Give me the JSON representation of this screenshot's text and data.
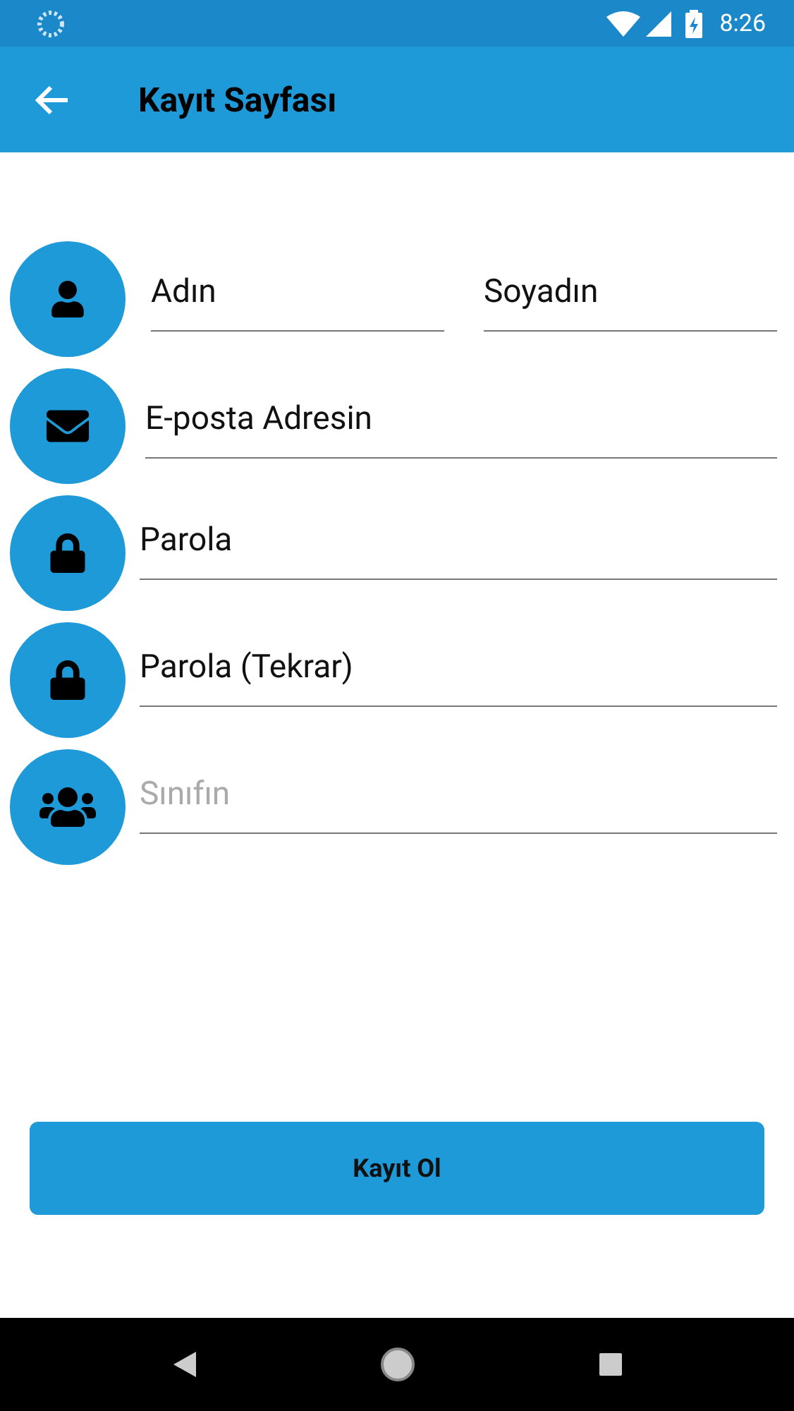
{
  "status_bar": {
    "time": "8:26"
  },
  "header": {
    "title": "Kayıt Sayfası"
  },
  "rows": [
    {
      "fields": [
        {
          "value": "Adın"
        },
        {
          "value": "Soyadın"
        }
      ]
    },
    {
      "fields": [
        {
          "value": "E-posta Adresin"
        }
      ]
    },
    {
      "fields": [
        {
          "value": "Parola"
        }
      ]
    },
    {
      "fields": [
        {
          "value": "Parola (Tekrar)"
        }
      ]
    },
    {
      "fields": [
        {
          "placeholder": "Sınıfın"
        }
      ]
    }
  ],
  "submit": {
    "label": "Kayıt Ol"
  }
}
